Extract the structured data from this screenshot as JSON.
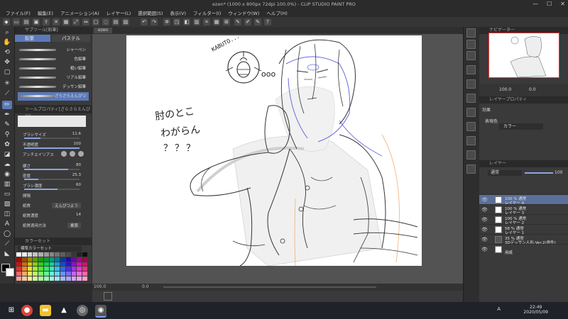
{
  "window": {
    "title": "ezen* (1000 x 800px 72dpi 100.0%) - CLIP STUDIO PAINT PRO",
    "min": "—",
    "max": "☐",
    "close": "✕"
  },
  "menu": [
    "ファイル(F)",
    "編集(E)",
    "アニメーション(A)",
    "レイヤー(L)",
    "選択範囲(S)",
    "表示(V)",
    "フィルター(I)",
    "ウィンドウ(W)",
    "ヘルプ(H)"
  ],
  "canvas_tab": "ezen",
  "subtool": {
    "header": "サブツール[鉛筆]",
    "tabs": [
      "鉛筆",
      "パステル"
    ],
    "brushes": [
      "シャーペン",
      "色鉛筆",
      "粗い鉛筆",
      "リアル鉛筆",
      "デッサン鉛筆",
      "ざらさらえんぴつ"
    ]
  },
  "toolprop": {
    "header": "ツールプロパティ[ざらさらえんぴつ]",
    "rows": [
      {
        "label": "ブラシサイズ",
        "value": "11.6"
      },
      {
        "label": "不透明度",
        "value": "100"
      },
      {
        "label": "アンチエイリアス",
        "value": ""
      },
      {
        "label": "硬さ",
        "value": "80"
      },
      {
        "label": "密度",
        "value": "25.3"
      },
      {
        "label": "ブラシ濃度",
        "value": "60"
      },
      {
        "label": "間隔",
        "value": ""
      },
      {
        "label": "紙質",
        "value": "えんぴつよう"
      },
      {
        "label": "紙質濃度",
        "value": "14"
      },
      {
        "label": "紙質適用方法",
        "value": "乗算"
      }
    ]
  },
  "colorset": {
    "header": "カラーセット",
    "selected": "標準カラーセット"
  },
  "sketch_text": {
    "kabuto": "KABUTO...",
    "ooo": "ooo",
    "line1": "肘のとこ",
    "line2": "わがらん",
    "line3": "？？？"
  },
  "status": {
    "zoom": "100.0",
    "pos": "0.0"
  },
  "navigator": {
    "header": "ナビゲーター",
    "zoom": "100.0",
    "angle": "0.0"
  },
  "layerprop": {
    "header": "レイヤープロパティ",
    "effect_label": "効果",
    "display_color_label": "表現色",
    "display_color": "カラー"
  },
  "layers": {
    "header": "レイヤー",
    "blend": "通常",
    "opacity": "100",
    "items": [
      {
        "l1": "100 % 通常",
        "l2": "レイヤー 4",
        "selected": true
      },
      {
        "l1": "100 % 通常",
        "l2": "レイヤー 3",
        "selected": false
      },
      {
        "l1": "100 % 通常",
        "l2": "レイヤー 2",
        "selected": false
      },
      {
        "l1": "58 % 通常",
        "l2": "レイヤー 1",
        "selected": false
      },
      {
        "l1": "35 % 通常",
        "l2": "3Dデッサン人形-Ver.2(男性)",
        "selected": false
      },
      {
        "l1": "",
        "l2": "用紙",
        "selected": false
      }
    ]
  },
  "taskbar": {
    "time": "22:49",
    "date": "2020/05/09",
    "ime": "A"
  },
  "colors": {
    "accent": "#5b79b8",
    "selected_layer": "#5a6f9a",
    "panel": "#3a3a3a",
    "canvas_bg": "#535353"
  }
}
